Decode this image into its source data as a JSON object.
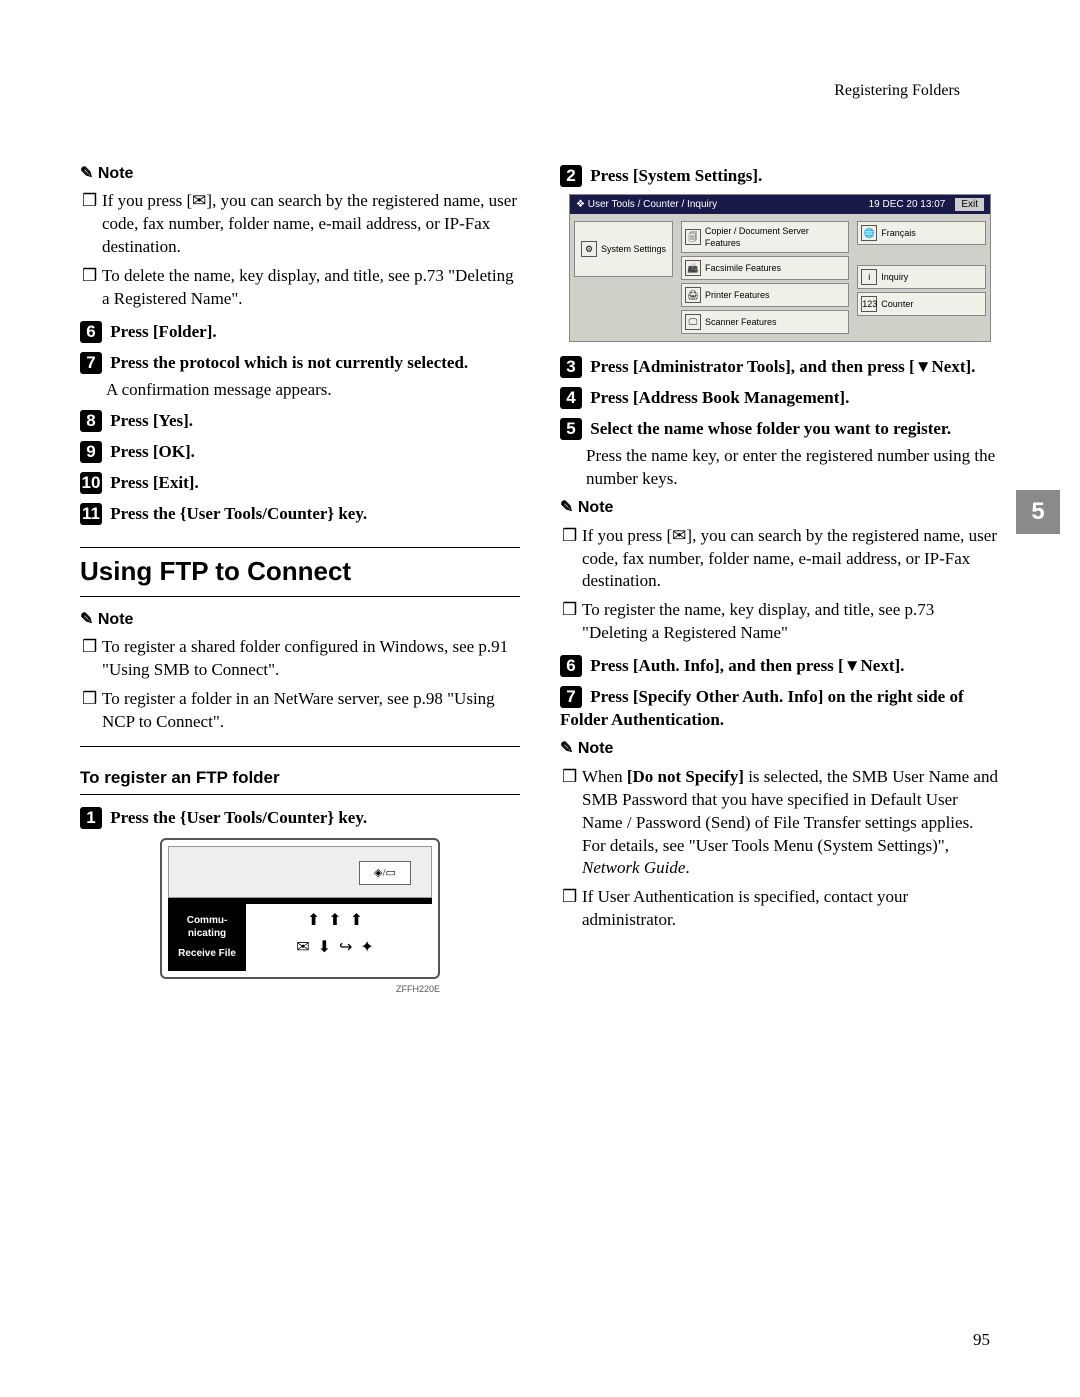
{
  "header": {
    "running": "Registering Folders"
  },
  "left": {
    "note1_items": [
      "If you press [✉], you can search by the registered name, user code, fax number, folder name, e-mail address, or IP-Fax destination.",
      "To delete the name, key display, and title, see p.73 \"Deleting a Registered Name\"."
    ],
    "step6": {
      "num": "6",
      "text": "Press [Folder]."
    },
    "step7": {
      "num": "7",
      "text": "Press the protocol which is not currently selected.",
      "sub": "A confirmation message appears."
    },
    "step8": {
      "num": "8",
      "text": "Press [Yes]."
    },
    "step9": {
      "num": "9",
      "text": "Press [OK]."
    },
    "step10": {
      "num": "10",
      "text": "Press [Exit]."
    },
    "step11": {
      "num": "11",
      "text": "Press the {User Tools/Counter} key."
    },
    "section_title": "Using FTP to Connect",
    "note2_items": [
      "To register a shared folder configured in Windows, see p.91 \"Using SMB to Connect\".",
      "To register a folder in an NetWare server, see p.98 \"Using NCP to Connect\"."
    ],
    "subsection": "To register an FTP folder",
    "stepA": {
      "num": "1",
      "text": "Press the {User Tools/Counter} key."
    },
    "panel": {
      "diamond": "◈/▭",
      "comm": "Commu-\nnicating",
      "recv": "Receive\nFile",
      "zcode": "ZFFH220E"
    }
  },
  "right": {
    "step2": {
      "num": "2",
      "text": "Press [System Settings]."
    },
    "ui": {
      "title": "User Tools / Counter / Inquiry",
      "timestamp": "19 DEC 20   13:07",
      "exit": "Exit",
      "syssettings": "System Settings",
      "copier": "Copier / Document Server Features",
      "fax": "Facsimile Features",
      "printer": "Printer Features",
      "scanner": "Scanner Features",
      "francais": "Français",
      "inquiry": "Inquiry",
      "counter": "Counter"
    },
    "step3": {
      "num": "3",
      "text": "Press [Administrator Tools], and then press [▼Next]."
    },
    "step4": {
      "num": "4",
      "text": "Press [Address Book Management]."
    },
    "step5": {
      "num": "5",
      "text": "Select the name whose folder you want to register.",
      "sub": "Press the name key, or enter the registered number using the number keys."
    },
    "note1_items": [
      "If you press [✉], you can search by the registered name, user code, fax number, folder name, e-mail address, or IP-Fax destination.",
      "To register the name, key display, and title, see p.73 \"Deleting a Registered Name\""
    ],
    "step6": {
      "num": "6",
      "text": "Press [Auth. Info], and then press [▼Next]."
    },
    "step7": {
      "num": "7",
      "text": "Press [Specify Other Auth. Info] on the right side of Folder Authentication."
    },
    "note2_items": [
      "When [Do not Specify] is selected, the SMB User Name and SMB Password that you have specified in Default User Name / Password (Send) of File Transfer settings applies. For details, see \"User Tools Menu (System Settings)\", Network Guide.",
      "If User Authentication is specified, contact your administrator."
    ]
  },
  "sidetab": "5",
  "pagenum": "95",
  "labels": {
    "note": "Note"
  }
}
